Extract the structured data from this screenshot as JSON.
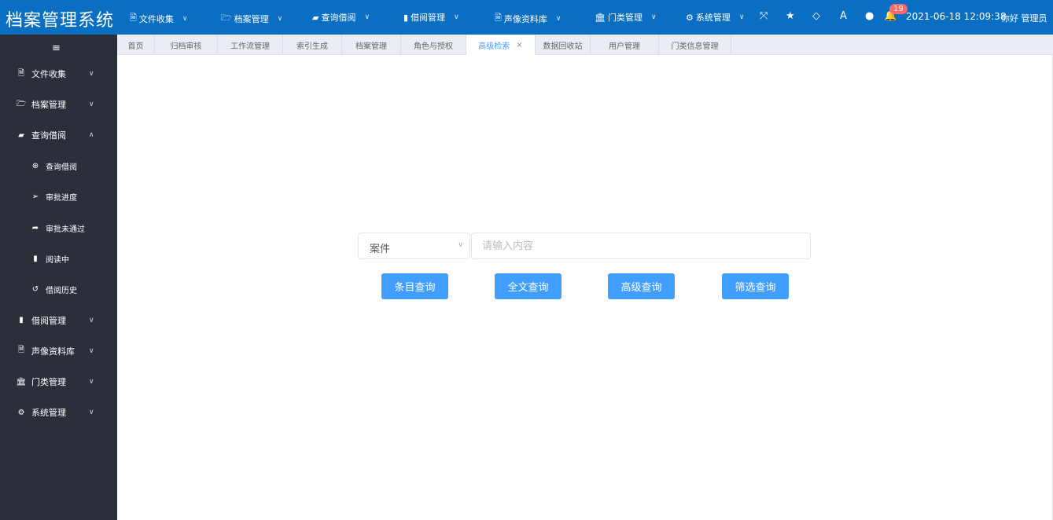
{
  "header": {
    "title": "档案管理系统",
    "nav": [
      {
        "label": "文件收集",
        "icon": "file-pdf-icon",
        "glyph": "🗎"
      },
      {
        "label": "档案管理",
        "icon": "folder-open-icon",
        "glyph": "🗁"
      },
      {
        "label": "查询借阅",
        "icon": "book-icon",
        "glyph": "▰"
      },
      {
        "label": "借阅管理",
        "icon": "bookmark-icon",
        "glyph": "▮"
      },
      {
        "label": "声像资料库",
        "icon": "file-video-icon",
        "glyph": "🗎"
      },
      {
        "label": "门类管理",
        "icon": "bank-icon",
        "glyph": "🏛"
      },
      {
        "label": "系统管理",
        "icon": "cogs-icon",
        "glyph": "⚙"
      }
    ],
    "tools": [
      {
        "name": "fullscreen-icon",
        "glyph": "⤧"
      },
      {
        "name": "star-icon",
        "glyph": "★"
      },
      {
        "name": "diamond-icon",
        "glyph": "◇"
      },
      {
        "name": "font-icon",
        "glyph": "A"
      },
      {
        "name": "user-icon",
        "glyph": "●"
      },
      {
        "name": "bell-icon",
        "glyph": "🔔"
      }
    ],
    "notification_count": "19",
    "datetime": "2021-06-18 12:09:38",
    "user": "你好 管理员"
  },
  "sidebar": {
    "toggle_glyph": "≡",
    "items": [
      {
        "label": "文件收集",
        "icon": "file-pdf-icon",
        "glyph": "🗎",
        "chevron": "∨"
      },
      {
        "label": "档案管理",
        "icon": "folder-open-icon",
        "glyph": "🗁",
        "chevron": "∨"
      },
      {
        "label": "查询借阅",
        "icon": "book-icon",
        "glyph": "▰",
        "chevron": "∧",
        "expanded": true
      },
      {
        "label": "查询借阅",
        "icon": "search-plus-icon",
        "glyph": "⊕",
        "sub": true
      },
      {
        "label": "审批进度",
        "icon": "paper-plane-icon",
        "glyph": "➢",
        "sub": true
      },
      {
        "label": "审批未通过",
        "icon": "share-icon",
        "glyph": "➦",
        "sub": true
      },
      {
        "label": "阅读中",
        "icon": "bookmark-icon",
        "glyph": "▮",
        "sub": true
      },
      {
        "label": "借阅历史",
        "icon": "history-icon",
        "glyph": "↺",
        "sub": true
      },
      {
        "label": "借阅管理",
        "icon": "bookmark-icon",
        "glyph": "▮",
        "chevron": "∨"
      },
      {
        "label": "声像资料库",
        "icon": "file-video-icon",
        "glyph": "🗎",
        "chevron": "∨"
      },
      {
        "label": "门类管理",
        "icon": "bank-icon",
        "glyph": "🏛",
        "chevron": "∨"
      },
      {
        "label": "系统管理",
        "icon": "cogs-icon",
        "glyph": "⚙",
        "chevron": "∨"
      }
    ]
  },
  "tabs": [
    {
      "label": "首页"
    },
    {
      "label": "归档审核"
    },
    {
      "label": "工作流管理"
    },
    {
      "label": "索引生成"
    },
    {
      "label": "档案管理"
    },
    {
      "label": "角色与授权"
    },
    {
      "label": "高级检索",
      "active": true,
      "close": "×"
    },
    {
      "label": "数据回收站"
    },
    {
      "label": "用户管理"
    },
    {
      "label": "门类信息管理"
    }
  ],
  "search": {
    "type_value": "案件",
    "placeholder": "请输入内容",
    "buttons": [
      "条目查询",
      "全文查询",
      "高级查询",
      "筛选查询"
    ]
  },
  "colors": {
    "header": "#0a6fc2",
    "sidebar": "#2b2f3a",
    "primary": "#409eff",
    "badge": "#f56c6c"
  }
}
